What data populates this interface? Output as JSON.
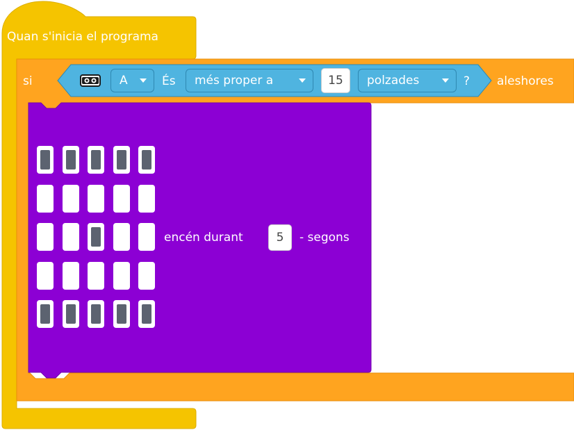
{
  "hat_block": {
    "label": "Quan s'inicia el programa"
  },
  "if_block": {
    "if_label": "si",
    "then_label": "aleshores",
    "condition": {
      "sensor_icon": "distance-sensor-icon",
      "port": "A",
      "is_label": "És",
      "comparison": "més proper a",
      "value": "15",
      "unit": "polzades",
      "question_mark": "?"
    }
  },
  "display_block": {
    "label_before": "encén durant",
    "duration": "5",
    "label_after": "- segons",
    "pixels": [
      [
        1,
        1,
        1,
        1,
        1
      ],
      [
        0,
        0,
        0,
        0,
        0
      ],
      [
        0,
        0,
        1,
        0,
        0
      ],
      [
        0,
        0,
        0,
        0,
        0
      ],
      [
        1,
        1,
        1,
        1,
        1
      ]
    ]
  },
  "colors": {
    "events_yellow": "#f5c400",
    "control_orange": "#ffa41f",
    "sensor_blue": "#4fb4e0",
    "display_purple": "#8c00d4",
    "led_on": "#5c6370",
    "led_off": "#ffffff"
  }
}
